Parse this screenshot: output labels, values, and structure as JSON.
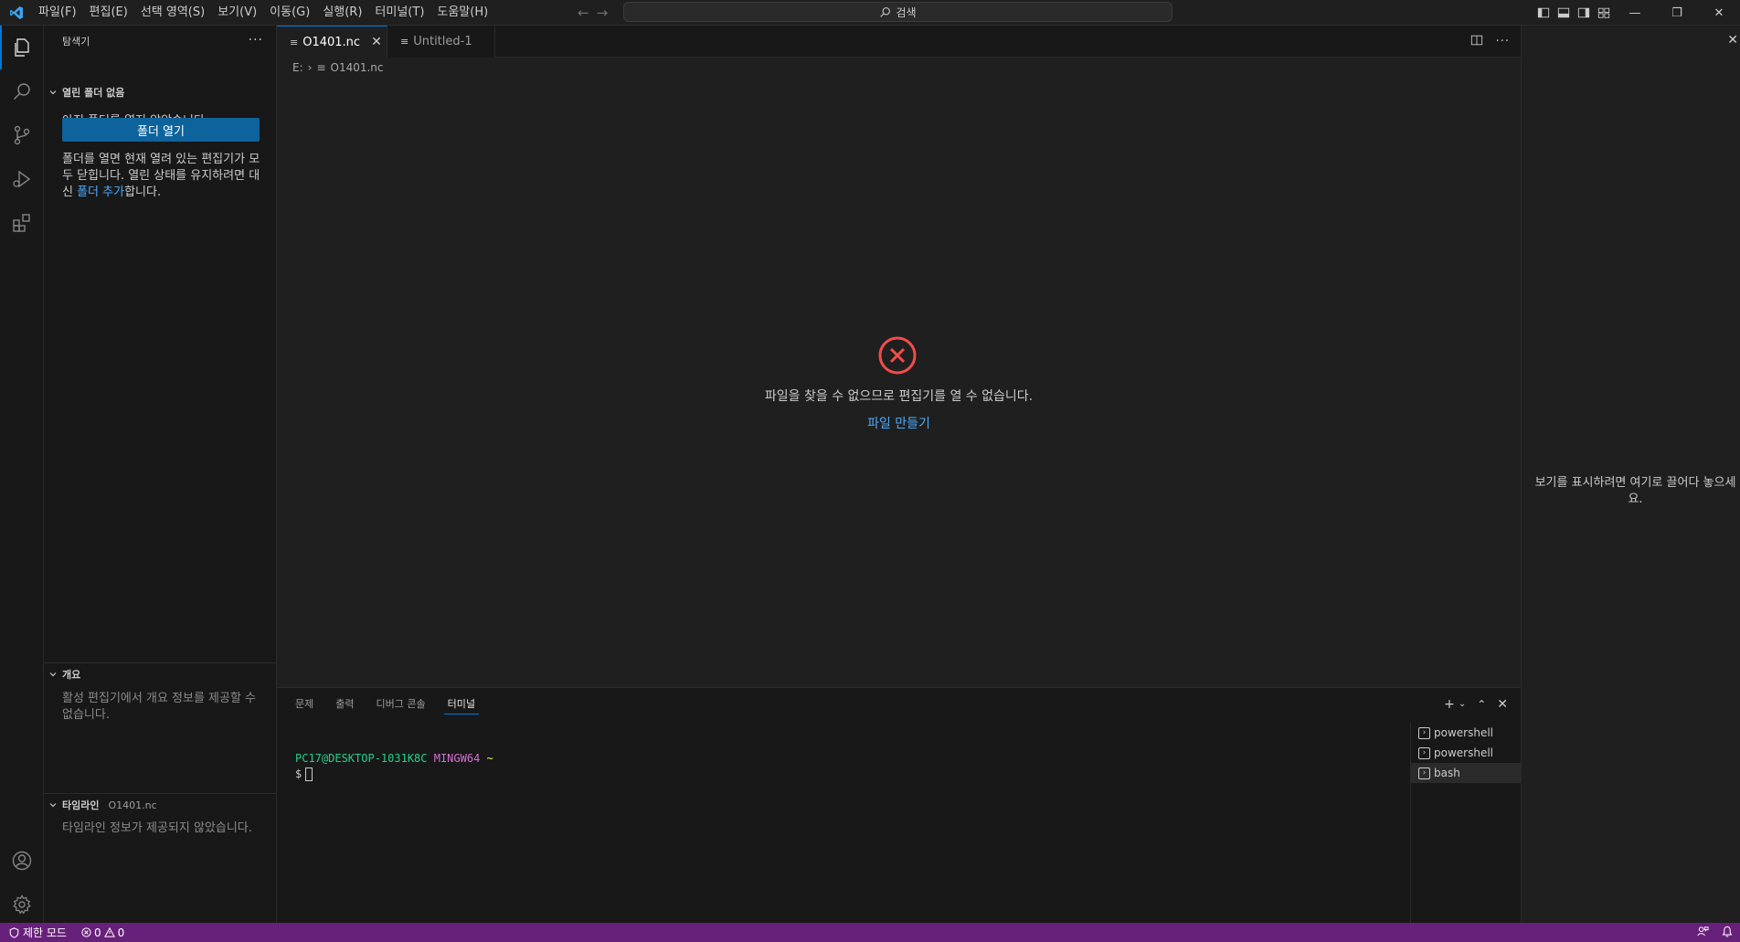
{
  "menu": {
    "items": [
      "파일(F)",
      "편집(E)",
      "선택 영역(S)",
      "보기(V)",
      "이동(G)",
      "실행(R)",
      "터미널(T)",
      "도움말(H)"
    ]
  },
  "search": {
    "label": "검색"
  },
  "sidebar": {
    "title": "탐색기",
    "no_folder": {
      "header": "열린 폴더 없음",
      "message": "아직 폴더를 열지 않았습니다.",
      "button": "폴더 열기",
      "note_before": "폴더를 열면 현재 열려 있는 편집기가 모두 닫힙니다. 열린 상태를 유지하려면 대신 ",
      "note_link": "폴더 추가",
      "note_after": "합니다."
    },
    "outline": {
      "header": "개요",
      "message": "활성 편집기에서 개요 정보를 제공할 수 없습니다."
    },
    "timeline": {
      "header": "타임라인",
      "file": "O1401.nc",
      "message": "타임라인 정보가 제공되지 않았습니다."
    }
  },
  "editor": {
    "tabs": [
      {
        "label": "O1401.nc",
        "active": true
      },
      {
        "label": "Untitled-1",
        "active": false
      }
    ],
    "breadcrumb": {
      "drive": "E:",
      "file": "O1401.nc"
    },
    "error_message": "파일을 찾을 수 없으므로 편집기를 열 수 없습니다.",
    "create_file_link": "파일 만들기"
  },
  "right_pane": {
    "hint": "보기를 표시하려면 여기로 끌어다 놓으세요."
  },
  "panel": {
    "tabs": [
      "문제",
      "출력",
      "디버그 콘솔",
      "터미널"
    ],
    "active_tab": "터미널",
    "terminal": {
      "user_host": "PC17@DESKTOP-1031K8C",
      "env": "MINGW64",
      "path": "~",
      "prompt": "$"
    },
    "terminals": [
      {
        "name": "powershell",
        "active": false
      },
      {
        "name": "powershell",
        "active": false
      },
      {
        "name": "bash",
        "active": true
      }
    ]
  },
  "statusbar": {
    "mode": "제한 모드",
    "errors": "0",
    "warnings": "0",
    "color": "#68217a"
  },
  "colors": {
    "accent": "#0078d4",
    "error_icon": "#f14c4c",
    "link": "#4daafc",
    "button": "#0e639c"
  }
}
